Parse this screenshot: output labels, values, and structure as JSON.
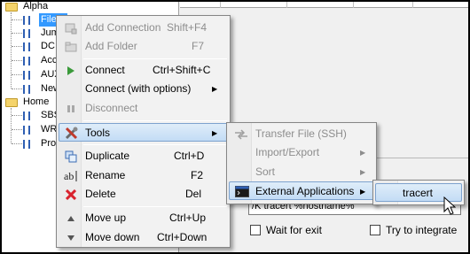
{
  "tree": {
    "groups": [
      {
        "name": "Alpha",
        "items": [
          "File S",
          "Jump",
          "DC",
          "Acco",
          "AUX",
          "New"
        ]
      },
      {
        "name": "Home",
        "items": [
          "SBS",
          "WRT",
          "Proc"
        ]
      }
    ]
  },
  "context_menu": {
    "items": [
      {
        "label": "Add Connection",
        "shortcut": "Shift+F4",
        "icon": "add-connection-icon",
        "disabled": true
      },
      {
        "label": "Add Folder",
        "shortcut": "F7",
        "icon": "add-folder-icon",
        "disabled": true
      },
      {
        "label": "Connect",
        "shortcut": "Ctrl+Shift+C",
        "icon": "play-icon",
        "disabled": false
      },
      {
        "label": "Connect (with options)",
        "shortcut": "",
        "icon": "",
        "disabled": false
      },
      {
        "label": "Disconnect",
        "shortcut": "",
        "icon": "pause-icon",
        "disabled": true
      },
      {
        "label": "Tools",
        "shortcut": "",
        "icon": "tools-icon",
        "disabled": false
      },
      {
        "label": "Duplicate",
        "shortcut": "Ctrl+D",
        "icon": "duplicate-icon",
        "disabled": false
      },
      {
        "label": "Rename",
        "shortcut": "F2",
        "icon": "rename-icon",
        "disabled": false
      },
      {
        "label": "Delete",
        "shortcut": "Del",
        "icon": "delete-icon",
        "disabled": false
      },
      {
        "label": "Move up",
        "shortcut": "Ctrl+Up",
        "icon": "move-up-icon",
        "disabled": false
      },
      {
        "label": "Move down",
        "shortcut": "Ctrl+Down",
        "icon": "move-down-icon",
        "disabled": false
      }
    ]
  },
  "tools_menu": {
    "items": [
      {
        "label": "Transfer File (SSH)",
        "disabled": true
      },
      {
        "label": "Import/Export",
        "disabled": true
      },
      {
        "label": "Sort",
        "disabled": true
      },
      {
        "label": "External Applications",
        "disabled": false
      }
    ]
  },
  "ext_apps_menu": {
    "items": [
      {
        "label": "tracert"
      }
    ]
  },
  "right_pane": {
    "command_value": "/K tracert %hostname%",
    "wait_for_exit_label": "Wait for exit",
    "try_integrate_label": "Try to integrate"
  },
  "colors": {
    "selection": "#3399ff",
    "menu_highlight": "#c3dcf5",
    "folder": "#f4d36b",
    "delete_red": "#d9232e",
    "play_green": "#3a9a3a"
  }
}
